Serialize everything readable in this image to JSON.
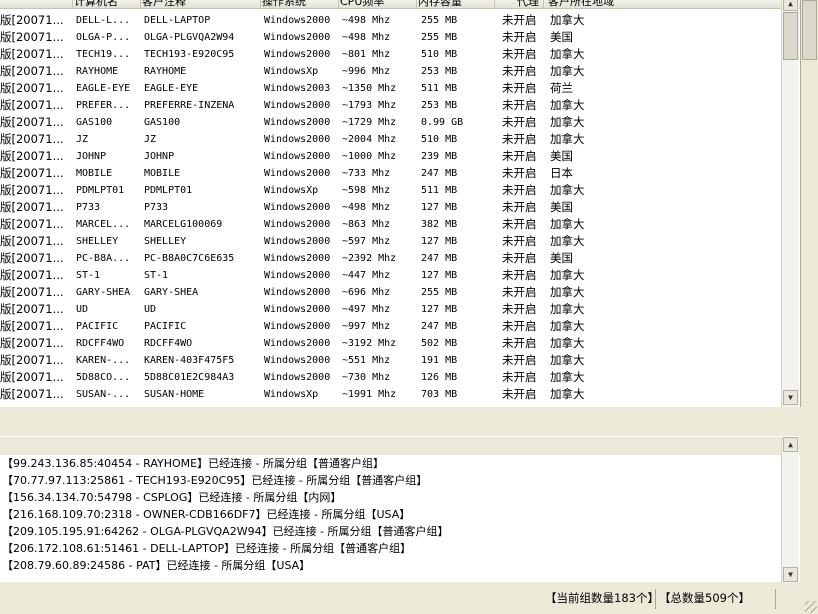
{
  "columns": [
    "",
    "计算机名",
    "客户注释",
    "操作系统",
    "CPU频率",
    "内存容量",
    "代理",
    "客户所在地域"
  ],
  "rows": [
    [
      "版[20071...",
      "DELL-L...",
      "DELL-LAPTOP",
      "Windows2000",
      "~498 Mhz",
      "255 MB",
      "未开启",
      "加拿大"
    ],
    [
      "版[20071...",
      "OLGA-P...",
      "OLGA-PLGVQA2W94",
      "Windows2000",
      "~498 Mhz",
      "255 MB",
      "未开启",
      "美国"
    ],
    [
      "版[20071...",
      "TECH19...",
      "TECH193-E920C95",
      "Windows2000",
      "~801 Mhz",
      "510 MB",
      "未开启",
      "加拿大"
    ],
    [
      "版[20071...",
      "RAYHOME",
      "RAYHOME",
      "WindowsXp",
      "~996 Mhz",
      "253 MB",
      "未开启",
      "加拿大"
    ],
    [
      "版[20071...",
      "EAGLE-EYE",
      "EAGLE-EYE",
      "Windows2003",
      "~1350 Mhz",
      "511 MB",
      "未开启",
      "荷兰"
    ],
    [
      "版[20071...",
      "PREFER...",
      "PREFERRE-INZENA",
      "Windows2000",
      "~1793 Mhz",
      "253 MB",
      "未开启",
      "加拿大"
    ],
    [
      "版[20071...",
      "GAS100",
      "GAS100",
      "Windows2000",
      "~1729 Mhz",
      "0.99 GB",
      "未开启",
      "加拿大"
    ],
    [
      "版[20071...",
      "JZ",
      "JZ",
      "Windows2000",
      "~2004 Mhz",
      "510 MB",
      "未开启",
      "加拿大"
    ],
    [
      "版[20071...",
      "JOHNP",
      "JOHNP",
      "Windows2000",
      "~1000 Mhz",
      "239 MB",
      "未开启",
      "美国"
    ],
    [
      "版[20071...",
      "MOBILE",
      "MOBILE",
      "Windows2000",
      "~733 Mhz",
      "247 MB",
      "未开启",
      "日本"
    ],
    [
      "版[20071...",
      "PDMLPT01",
      "PDMLPT01",
      "WindowsXp",
      "~598 Mhz",
      "511 MB",
      "未开启",
      "加拿大"
    ],
    [
      "版[20071...",
      "P733",
      "P733",
      "Windows2000",
      "~498 Mhz",
      "127 MB",
      "未开启",
      "美国"
    ],
    [
      "版[20071...",
      "MARCEL...",
      "MARCELG100069",
      "Windows2000",
      "~863 Mhz",
      "382 MB",
      "未开启",
      "加拿大"
    ],
    [
      "版[20071...",
      "SHELLEY",
      "SHELLEY",
      "Windows2000",
      "~597 Mhz",
      "127 MB",
      "未开启",
      "加拿大"
    ],
    [
      "版[20071...",
      "PC-B8A...",
      "PC-B8A0C7C6E635",
      "Windows2000",
      "~2392 Mhz",
      "247 MB",
      "未开启",
      "美国"
    ],
    [
      "版[20071...",
      "ST-1",
      "ST-1",
      "Windows2000",
      "~447 Mhz",
      "127 MB",
      "未开启",
      "加拿大"
    ],
    [
      "版[20071...",
      "GARY-SHEA",
      "GARY-SHEA",
      "Windows2000",
      "~696 Mhz",
      "255 MB",
      "未开启",
      "加拿大"
    ],
    [
      "版[20071...",
      "UD",
      "UD",
      "Windows2000",
      "~497 Mhz",
      "127 MB",
      "未开启",
      "加拿大"
    ],
    [
      "版[20071...",
      "PACIFIC",
      "PACIFIC",
      "Windows2000",
      "~997 Mhz",
      "247 MB",
      "未开启",
      "加拿大"
    ],
    [
      "版[20071...",
      "RDCFF4WO",
      "RDCFF4WO",
      "Windows2000",
      "~3192 Mhz",
      "502 MB",
      "未开启",
      "加拿大"
    ],
    [
      "版[20071...",
      "KAREN-...",
      "KAREN-403F475F5",
      "Windows2000",
      "~551 Mhz",
      "191 MB",
      "未开启",
      "加拿大"
    ],
    [
      "版[20071...",
      "5D88CO...",
      "5D88C01E2C984A3",
      "Windows2000",
      "~730 Mhz",
      "126 MB",
      "未开启",
      "加拿大"
    ],
    [
      "版[20071...",
      "SUSAN-...",
      "SUSAN-HOME",
      "WindowsXp",
      "~1991 Mhz",
      "703 MB",
      "未开启",
      "加拿大"
    ]
  ],
  "log": [
    "【99.243.136.85:40454 - RAYHOME】已经连接 - 所属分组【普通客户组】",
    "【70.77.97.113:25861 - TECH193-E920C95】已经连接 - 所属分组【普通客户组】",
    "【156.34.134.70:54798 - CSPLOG】已经连接 - 所属分组【内网】",
    "【216.168.109.70:2318 - OWNER-CDB166DF7】已经连接 - 所属分组【USA】",
    "【209.105.195.91:64262 - OLGA-PLGVQA2W94】已经连接 - 所属分组【普通客户组】",
    "【206.172.108.61:51461 - DELL-LAPTOP】已经连接 - 所属分组【普通客户组】",
    "【208.79.60.89:24586 - PAT】已经连接 - 所属分组【USA】"
  ],
  "status": {
    "current_group": "【当前组数量183个】",
    "total": "【总数量509个】"
  }
}
